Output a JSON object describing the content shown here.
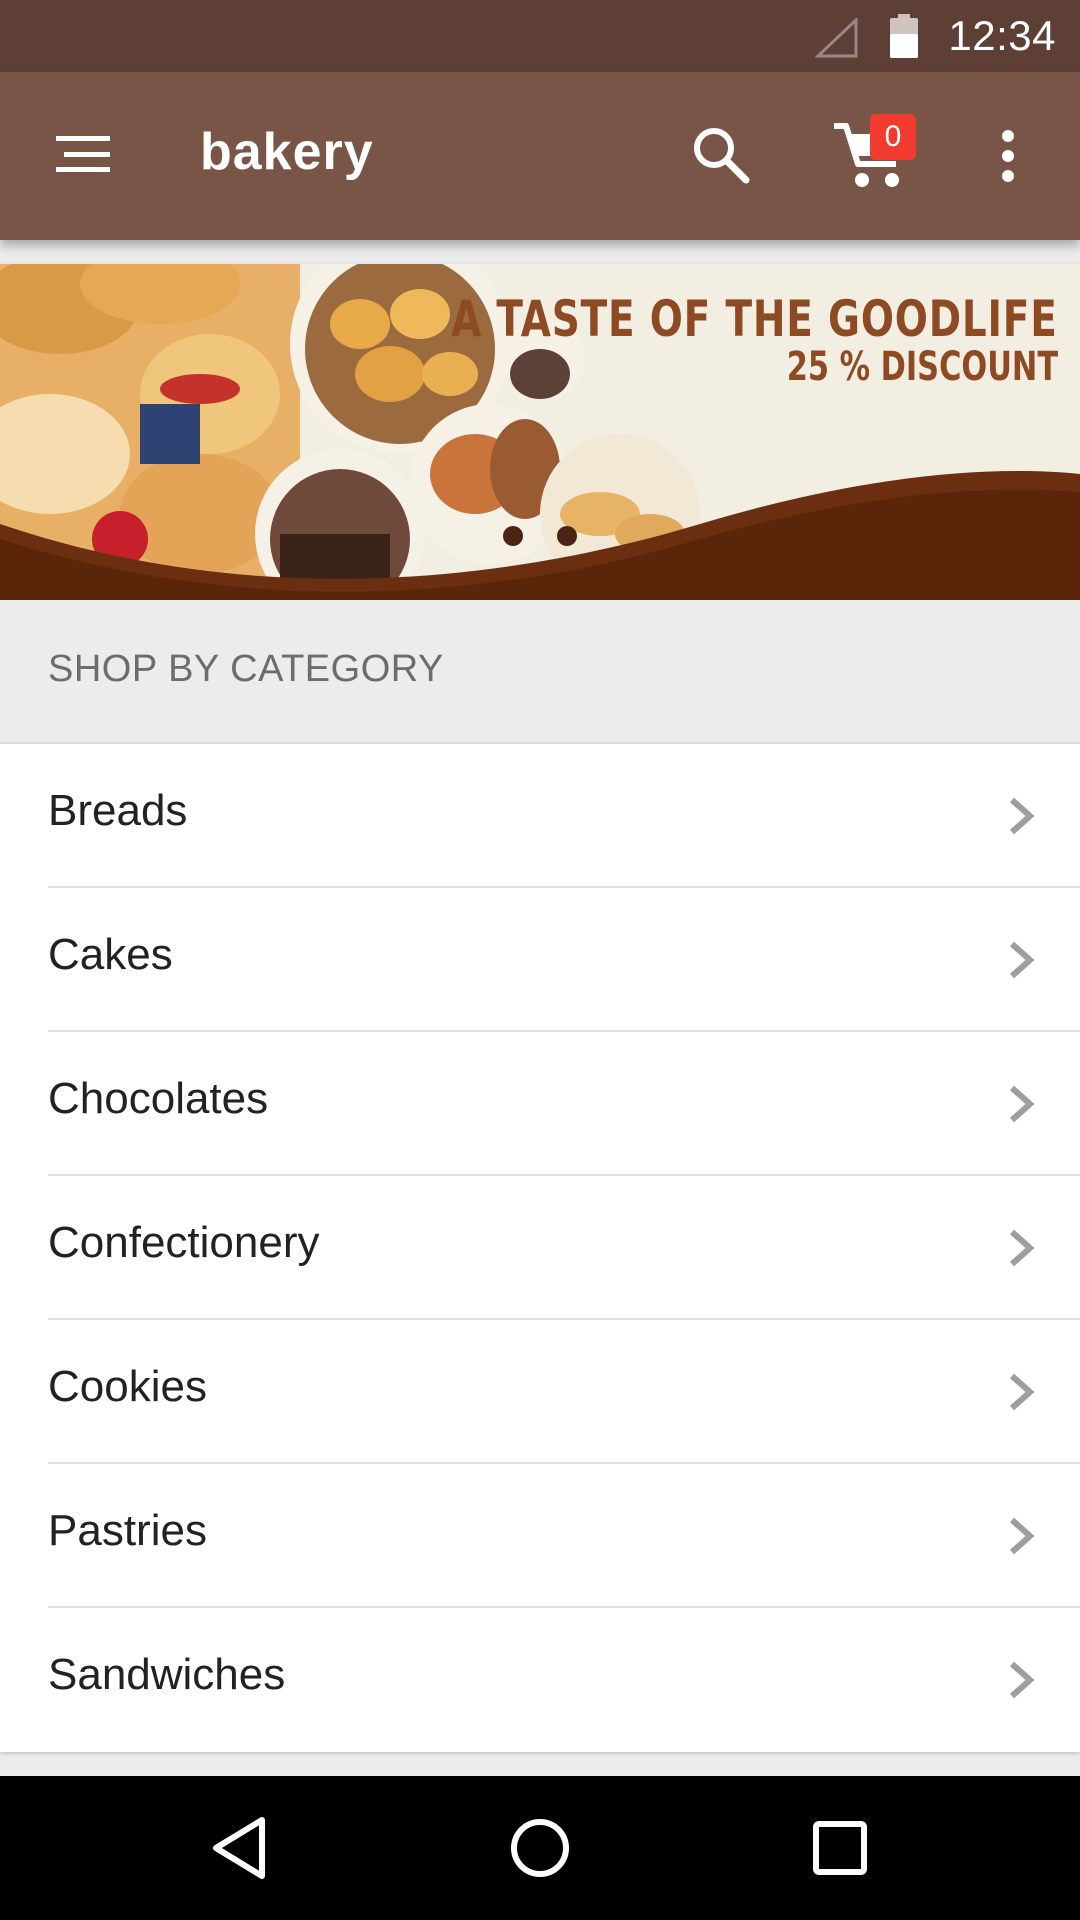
{
  "status_bar": {
    "time": "12:34",
    "icons": [
      "cell-signal-icon",
      "battery-icon"
    ]
  },
  "app_bar": {
    "title": "bakery",
    "cart_count": "0",
    "icons": [
      "menu-icon",
      "search-icon",
      "cart-icon",
      "overflow-menu-icon"
    ],
    "color": "#795548"
  },
  "banner": {
    "headline": "A TASTE OF THE GOODLIFE",
    "subline": "25 % DISCOUNT"
  },
  "section": {
    "title": "SHOP BY CATEGORY"
  },
  "categories": [
    {
      "label": "Breads"
    },
    {
      "label": "Cakes"
    },
    {
      "label": "Chocolates"
    },
    {
      "label": "Confectionery"
    },
    {
      "label": "Cookies"
    },
    {
      "label": "Pastries"
    },
    {
      "label": "Sandwiches"
    }
  ],
  "nav_bar": {
    "icons": [
      "back-icon",
      "home-icon",
      "recents-icon"
    ]
  },
  "colors": {
    "status_bar": "#5d3f36",
    "accent_badge": "#f23b2f",
    "banner_text": "#8e4a22"
  }
}
